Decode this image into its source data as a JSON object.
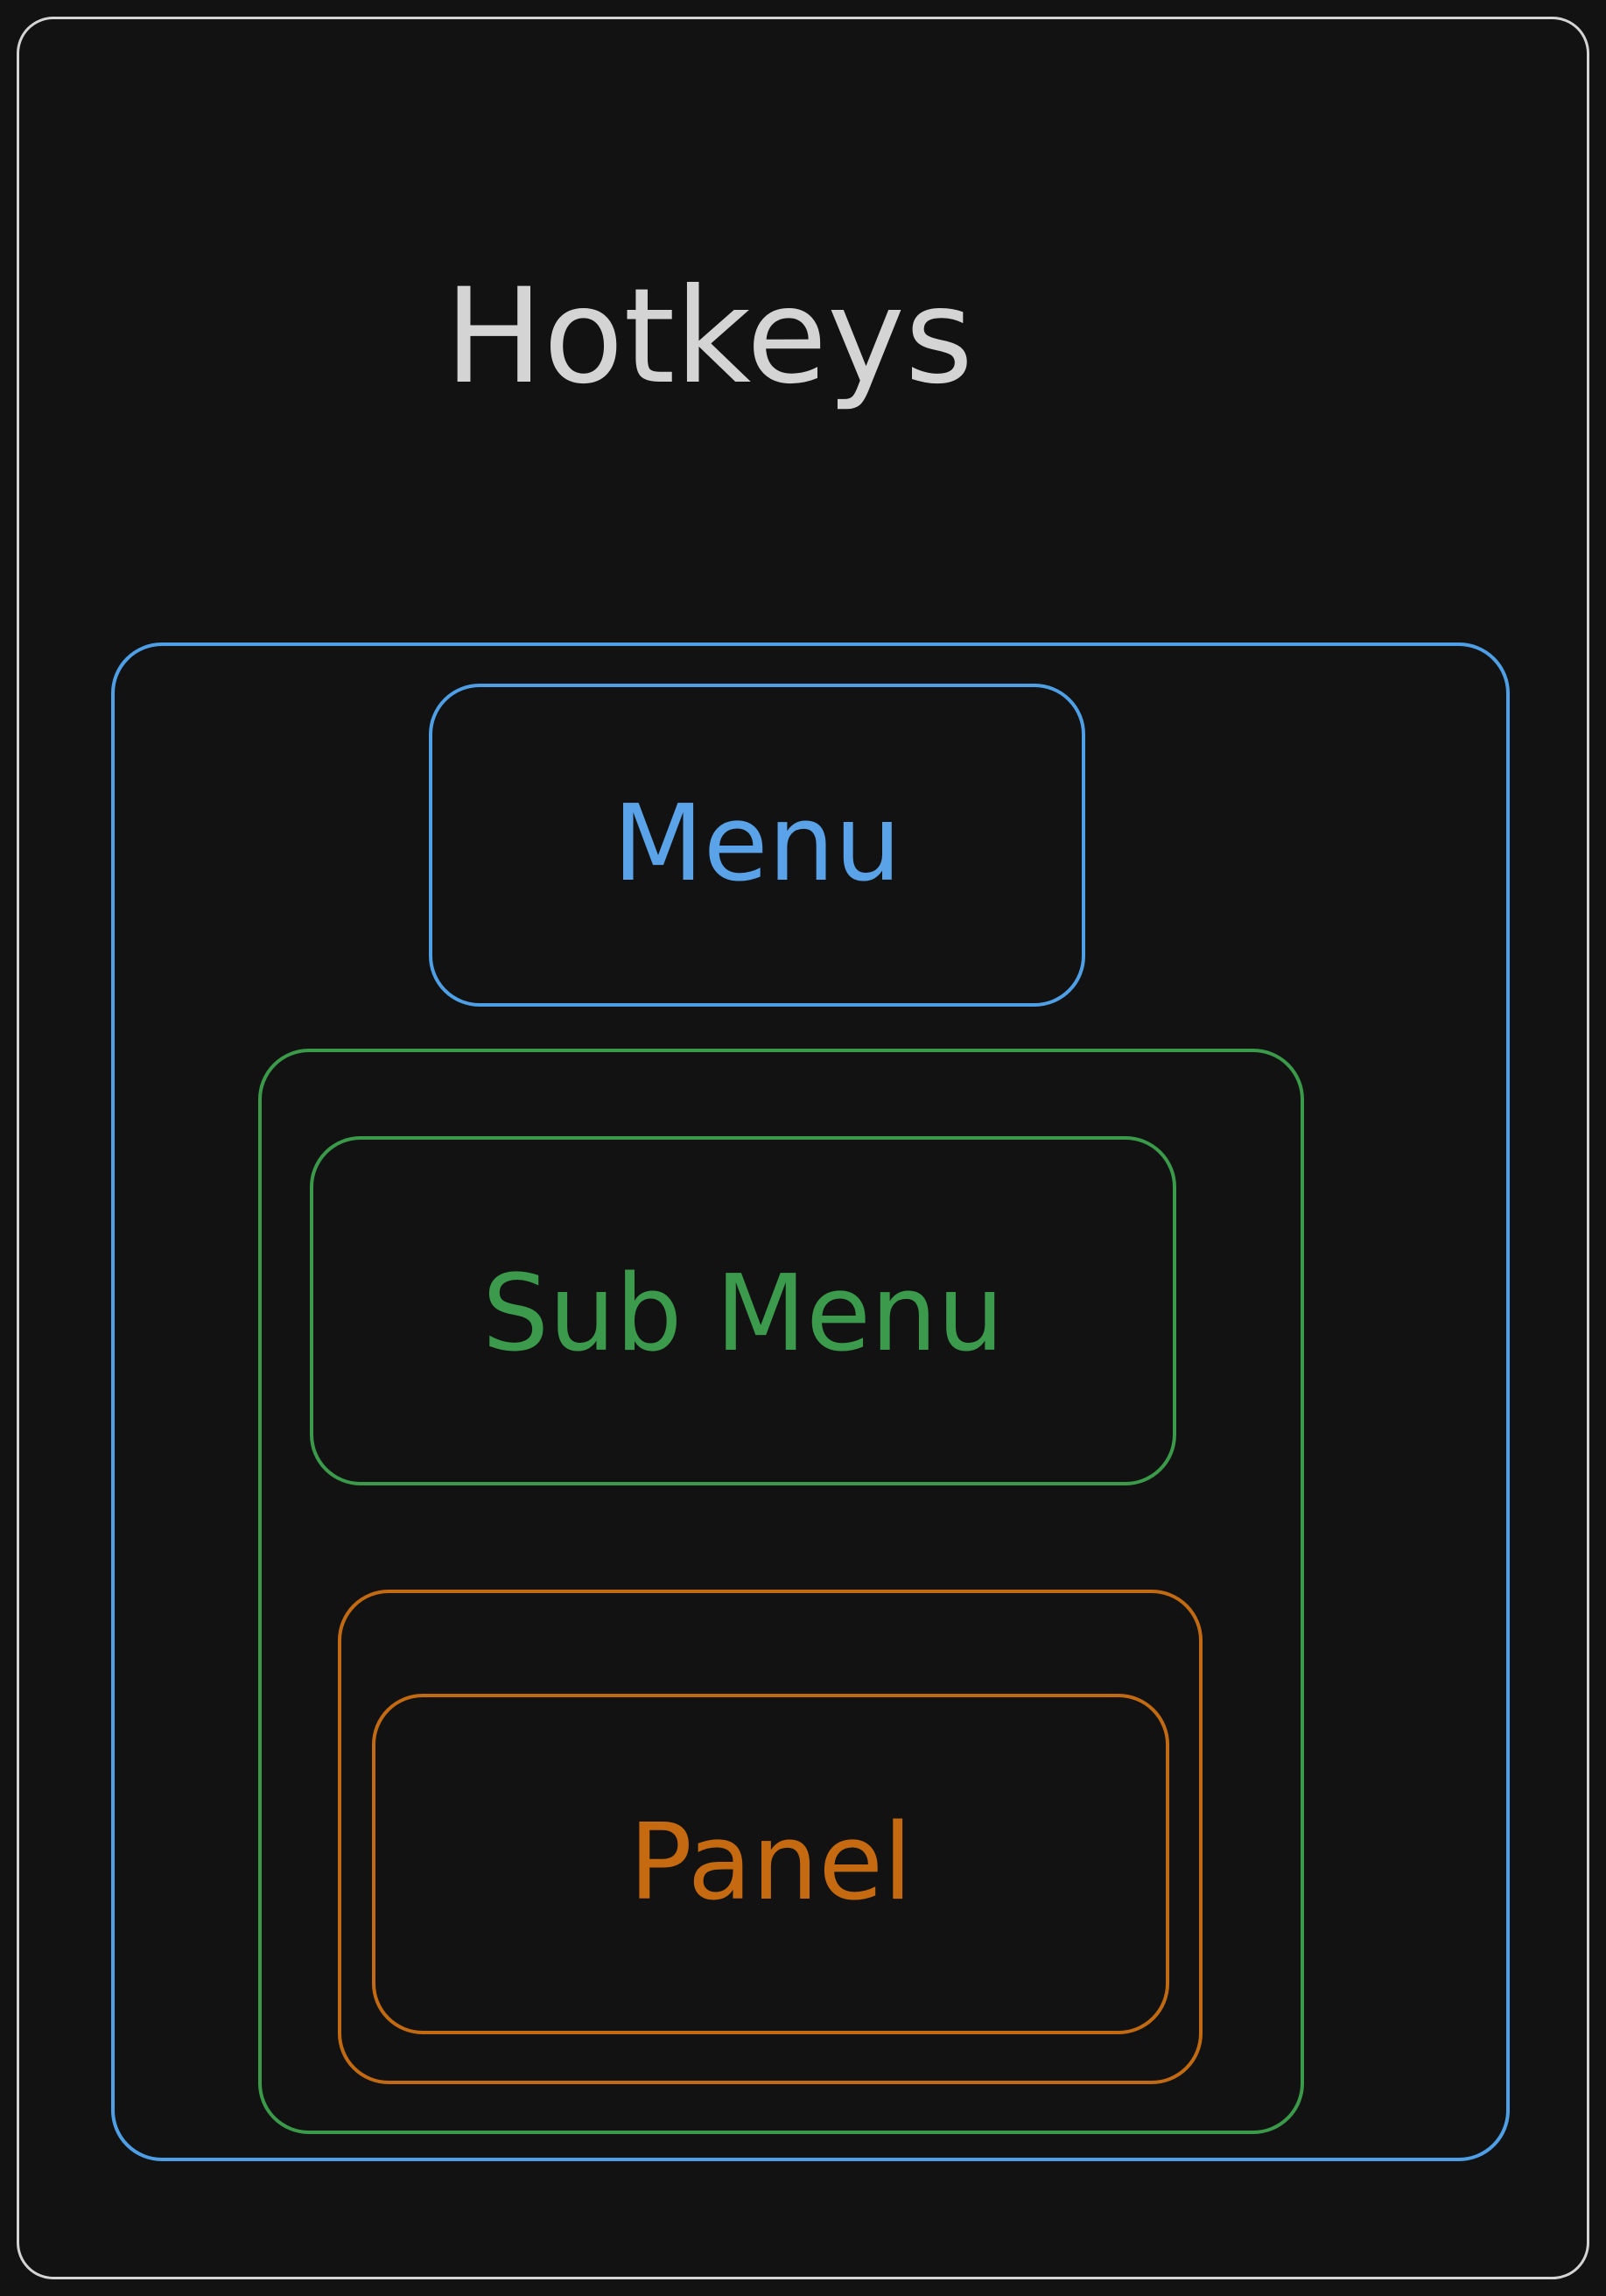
{
  "diagram": {
    "title": "Hotkeys",
    "nodes": {
      "menu": {
        "label": "Menu",
        "color": "#5aa3e8"
      },
      "submenu": {
        "label": "Sub Menu",
        "color": "#3c9a4c"
      },
      "panel": {
        "label": "Panel",
        "color": "#c56a10"
      }
    },
    "colors": {
      "background": "#121212",
      "frame": "#d4d4d4"
    }
  }
}
